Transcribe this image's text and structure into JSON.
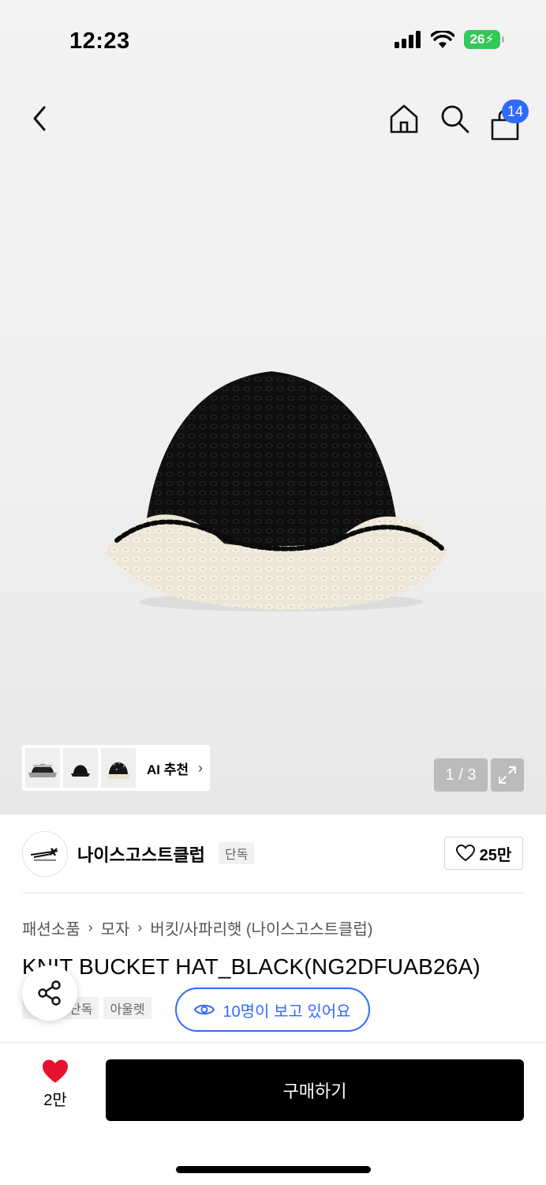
{
  "status_bar": {
    "time": "12:23",
    "battery": "26"
  },
  "nav": {
    "cart_count": "14"
  },
  "gallery": {
    "ai_recommend_label": "AI 추천",
    "page_indicator": "1 / 3"
  },
  "brand": {
    "name": "나이스고스트클럽",
    "tag": "단독",
    "like_count": "25만"
  },
  "breadcrumb": [
    "패션소품",
    "모자",
    "버킷/사파리햇 (나이스고스트클럽)"
  ],
  "product": {
    "title": "KNIT BUCKET HAT_BLACK(NG2DFUAB26A)",
    "tags": [
      "단독",
      "아울렛"
    ],
    "viewers_text": "10명이 보고 있어요"
  },
  "bottom_bar": {
    "wish_count": "2만",
    "buy_label": "구매하기"
  },
  "colors": {
    "accent_blue": "#2f6bff",
    "heart_red": "#e8112d",
    "battery_green": "#34c759"
  },
  "icons": [
    "back-icon",
    "home-icon",
    "search-icon",
    "bag-icon",
    "expand-icon",
    "heart-outline-icon",
    "eye-icon",
    "share-icon",
    "heart-filled-icon"
  ]
}
